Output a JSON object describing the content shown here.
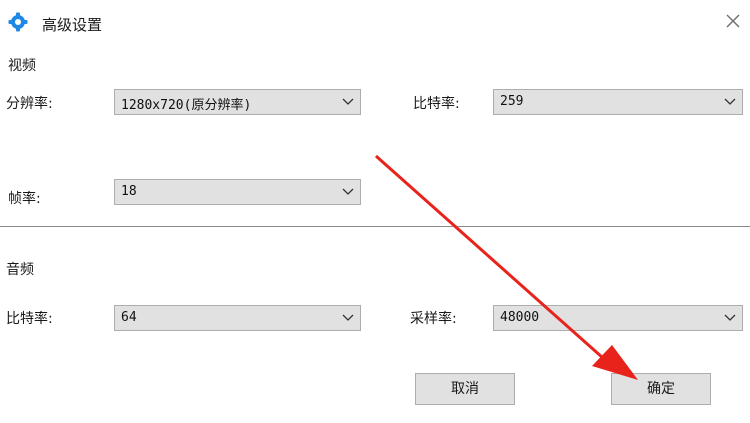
{
  "dialog": {
    "title": "高级设置",
    "close_icon": "close-icon",
    "app_icon": "settings-gear-icon",
    "accent_color": "#1e88e5"
  },
  "video": {
    "section_label": "视频",
    "resolution": {
      "label": "分辨率:",
      "value": "1280x720(原分辨率)"
    },
    "bitrate": {
      "label": "比特率:",
      "value": "259"
    },
    "framerate": {
      "label": "帧率:",
      "value": "18"
    }
  },
  "audio": {
    "section_label": "音频",
    "bitrate": {
      "label": "比特率:",
      "value": "64"
    },
    "samplerate": {
      "label": "采样率:",
      "value": "48000"
    }
  },
  "buttons": {
    "cancel": "取消",
    "confirm": "确定"
  },
  "annotation": {
    "arrow_color": "#e8231b",
    "points_to": "confirm-button"
  }
}
